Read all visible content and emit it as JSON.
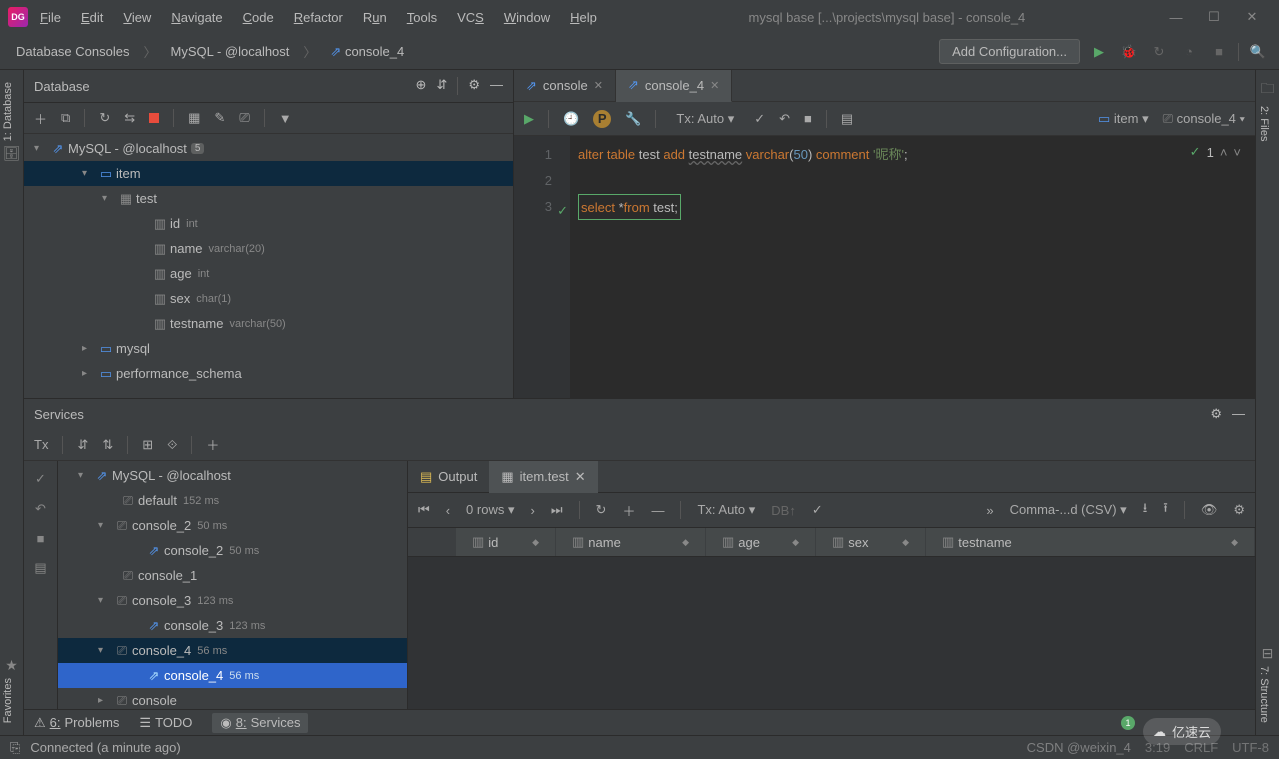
{
  "window": {
    "title": "mysql base [...\\projects\\mysql base] - console_4"
  },
  "menu": {
    "file": "File",
    "edit": "Edit",
    "view": "View",
    "navigate": "Navigate",
    "code": "Code",
    "refactor": "Refactor",
    "run": "Run",
    "tools": "Tools",
    "vcs": "VCS",
    "window": "Window",
    "help": "Help"
  },
  "breadcrumb": {
    "a": "Database Consoles",
    "b": "MySQL - @localhost",
    "c": "console_4",
    "add_config": "Add Configuration..."
  },
  "db_panel": {
    "title": "Database",
    "root": "MySQL - @localhost",
    "root_badge": "5",
    "schema_item": "item",
    "table_test": "test",
    "cols": [
      {
        "name": "id",
        "type": "int"
      },
      {
        "name": "name",
        "type": "varchar(20)"
      },
      {
        "name": "age",
        "type": "int"
      },
      {
        "name": "sex",
        "type": "char(1)"
      },
      {
        "name": "testname",
        "type": "varchar(50)"
      }
    ],
    "mysql": "mysql",
    "perf": "performance_schema"
  },
  "editor": {
    "tab1": "console",
    "tab2": "console_4",
    "tx": "Tx: Auto",
    "target1": "item",
    "target2": "console_4",
    "marker_count": "1",
    "code": {
      "l1_k1": "alter",
      "l1_k2": "table",
      "l1_t1": "test",
      "l1_k3": "add",
      "l1_col": "testname",
      "l1_k4": "varchar",
      "l1_paren_o": "(",
      "l1_num": "50",
      "l1_paren_c": ")",
      "l1_k5": "comment",
      "l1_str": "'昵称'",
      "l1_semi": ";",
      "l3_k1": "select",
      "l3_star": "*",
      "l3_k2": "from",
      "l3_t1": "test",
      "l3_semi": ";"
    }
  },
  "services": {
    "title": "Services",
    "root": "MySQL - @localhost",
    "default": "default",
    "default_ms": "152 ms",
    "c2": "console_2",
    "c2_ms": "50 ms",
    "c2b": "console_2",
    "c2b_ms": "50 ms",
    "c1": "console_1",
    "c3": "console_3",
    "c3_ms": "123 ms",
    "c3b": "console_3",
    "c3b_ms": "123 ms",
    "c4": "console_4",
    "c4_ms": "56 ms",
    "c4b": "console_4",
    "c4b_ms": "56 ms",
    "c5": "console",
    "tx_label": "Tx",
    "tab_output": "Output",
    "tab_table": "item.test",
    "rows": "0 rows",
    "tx": "Tx: Auto",
    "format": "Comma-...d (CSV)",
    "columns": [
      "id",
      "name",
      "age",
      "sex",
      "testname"
    ]
  },
  "bottom": {
    "problems": "Problems",
    "problems_key": "6:",
    "todo": "TODO",
    "services": "Services",
    "services_key": "8:"
  },
  "status": {
    "msg": "Connected (a minute ago)",
    "pos": "3:19",
    "sep": "CRLF",
    "enc": "UTF-8",
    "csdn": "CSDN @weixin_4",
    "brand": "亿速云"
  },
  "rail": {
    "database": "1: Database",
    "favorites": "Favorites",
    "files": "2: Files",
    "structure": "7: Structure"
  }
}
